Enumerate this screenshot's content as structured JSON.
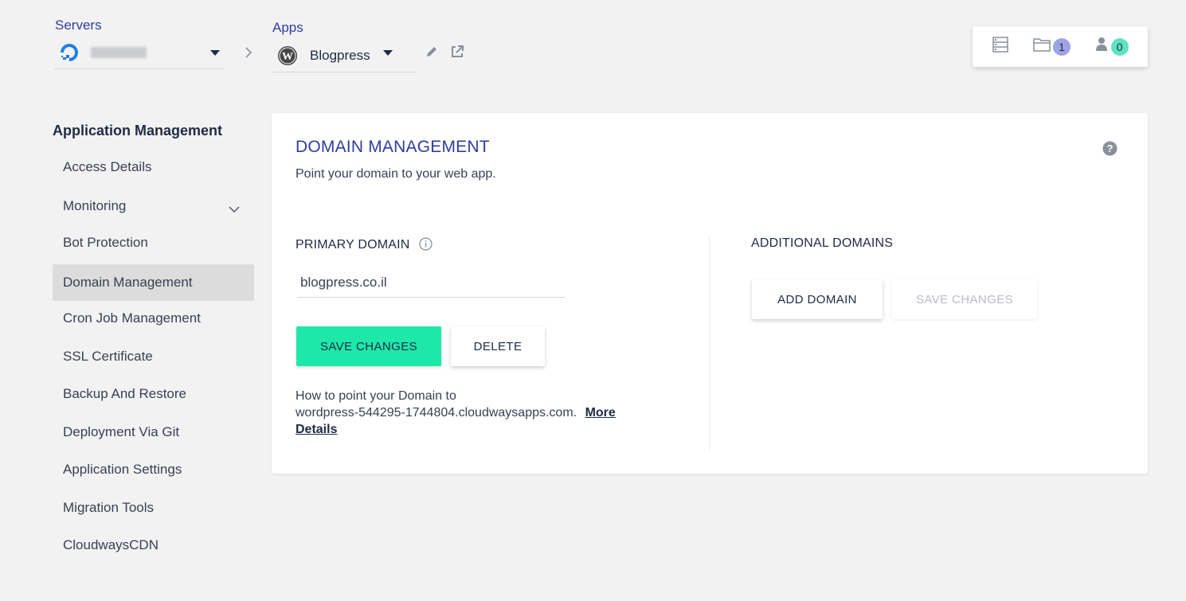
{
  "header": {
    "servers_label": "Servers",
    "apps_label": "Apps",
    "app_name": "Blogpress",
    "counters": {
      "projects_count": "1",
      "team_count": "0",
      "projects_badge_color": "#9ea3e6",
      "team_badge_color": "#5ee3c1"
    }
  },
  "sidebar": {
    "title": "Application Management",
    "items": [
      {
        "label": "Access Details"
      },
      {
        "label": "Monitoring"
      },
      {
        "label": "Bot Protection"
      },
      {
        "label": "Domain Management"
      },
      {
        "label": "Cron Job Management"
      },
      {
        "label": "SSL Certificate"
      },
      {
        "label": "Backup And Restore"
      },
      {
        "label": "Deployment Via Git"
      },
      {
        "label": "Application Settings"
      },
      {
        "label": "Migration Tools"
      },
      {
        "label": "CloudwaysCDN"
      }
    ],
    "active_item": "Domain Management"
  },
  "panel": {
    "title": "DOMAIN MANAGEMENT",
    "subtitle": "Point your domain to your web app.",
    "primary": {
      "heading": "PRIMARY DOMAIN",
      "domain_value": "blogpress.co.il",
      "save_label": "SAVE CHANGES",
      "delete_label": "DELETE",
      "help_line1": "How to point your Domain to",
      "help_line2": "wordpress-544295-1744804.cloudwaysapps.com.",
      "more_details_link": "More Details"
    },
    "additional": {
      "heading": "ADDITIONAL DOMAINS",
      "add_label": "ADD DOMAIN",
      "save_label": "SAVE CHANGES"
    }
  },
  "colors": {
    "accent_blue": "#2f3d9e",
    "primary_button": "#1ee8a9",
    "background": "#f2f2f2"
  }
}
